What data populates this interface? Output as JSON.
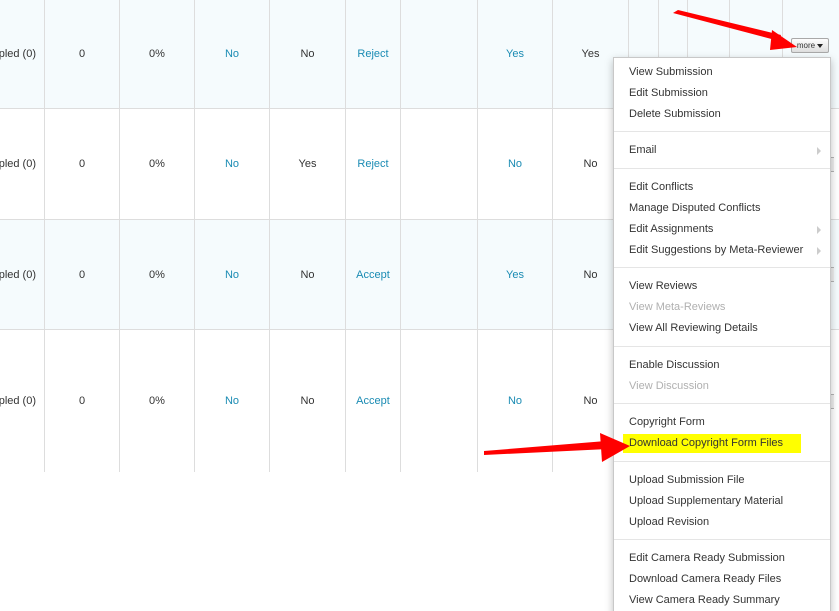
{
  "table": {
    "rows": [
      {
        "c0": "pled (0)",
        "c1": "0",
        "c2": "0%",
        "c3": "No",
        "c4": "No",
        "c5": "Reject",
        "c6": "",
        "c7": "Yes",
        "c8": "Yes"
      },
      {
        "c0": "pled (0)",
        "c1": "0",
        "c2": "0%",
        "c3": "No",
        "c4": "Yes",
        "c5": "Reject",
        "c6": "",
        "c7": "No",
        "c8": "No"
      },
      {
        "c0": "pled (0)",
        "c1": "0",
        "c2": "0%",
        "c3": "No",
        "c4": "No",
        "c5": "Accept",
        "c6": "",
        "c7": "Yes",
        "c8": "No"
      },
      {
        "c0": "pled (0)",
        "c1": "0",
        "c2": "0%",
        "c3": "No",
        "c4": "No",
        "c5": "Accept",
        "c6": "",
        "c7": "No",
        "c8": "No"
      }
    ]
  },
  "more_button": {
    "label": "more"
  },
  "menu": {
    "view_submission": "View Submission",
    "edit_submission": "Edit Submission",
    "delete_submission": "Delete Submission",
    "email": "Email",
    "edit_conflicts": "Edit Conflicts",
    "manage_disputed_conflicts": "Manage Disputed Conflicts",
    "edit_assignments": "Edit Assignments",
    "edit_suggestions": "Edit Suggestions by Meta-Reviewer",
    "view_reviews": "View Reviews",
    "view_meta_reviews": "View Meta-Reviews",
    "view_all_reviewing_details": "View All Reviewing Details",
    "enable_discussion": "Enable Discussion",
    "view_discussion": "View Discussion",
    "copyright_form": "Copyright Form",
    "download_copyright_form_files": "Download Copyright Form Files",
    "upload_submission_file": "Upload Submission File",
    "upload_supplementary_material": "Upload Supplementary Material",
    "upload_revision": "Upload Revision",
    "edit_camera_ready_submission": "Edit Camera Ready Submission",
    "download_camera_ready_files": "Download Camera Ready Files",
    "view_camera_ready_summary": "View Camera Ready Summary"
  },
  "colors": {
    "link": "#1a8bb3",
    "highlight": "#ffff00",
    "annotation_arrow": "#ff0000",
    "alt_row": "#f5fbfd"
  }
}
